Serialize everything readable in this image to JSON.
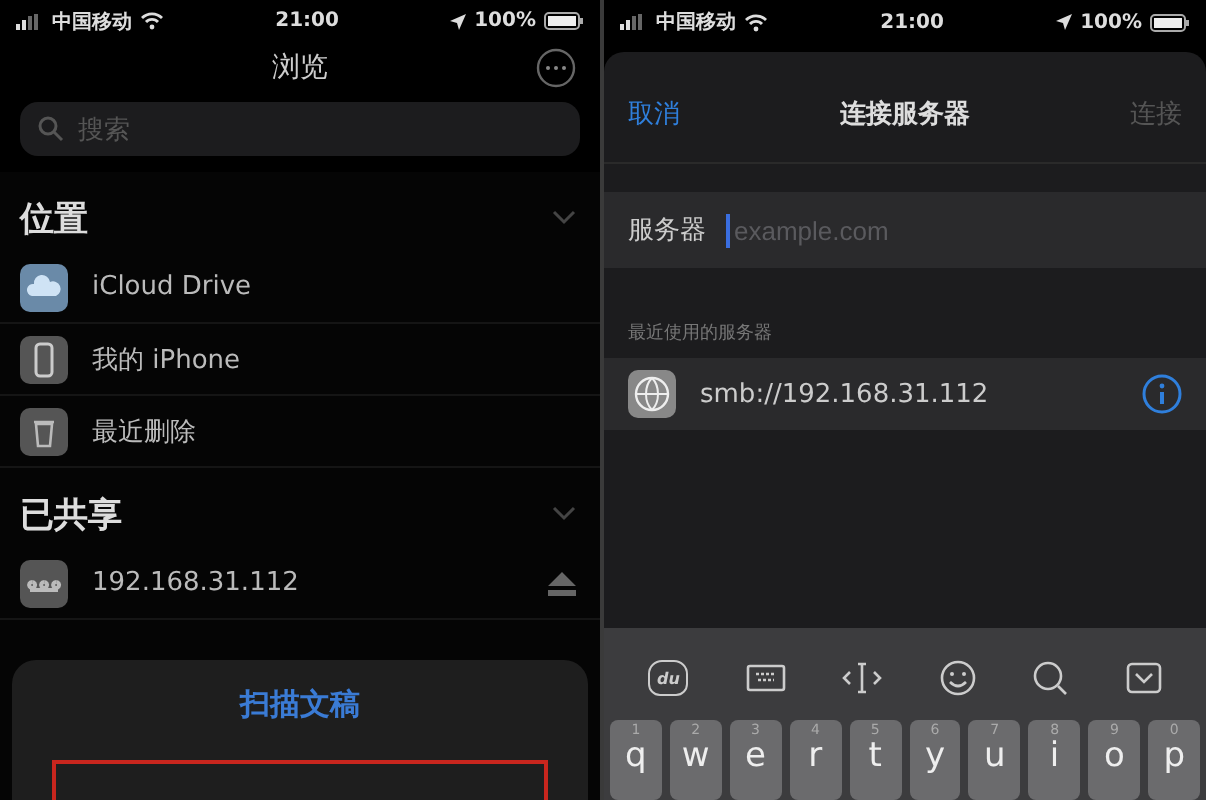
{
  "left": {
    "status": {
      "carrier": "中国移动",
      "time": "21:00",
      "battery": "100%"
    },
    "title": "浏览",
    "search": {
      "placeholder": "搜索"
    },
    "sections": [
      {
        "title": "位置",
        "expanded": true,
        "items": [
          {
            "label": "iCloud Drive",
            "kind": "cloud"
          },
          {
            "label": "我的 iPhone",
            "kind": "phone"
          },
          {
            "label": "最近删除",
            "kind": "trash"
          }
        ]
      },
      {
        "title": "已共享",
        "expanded": true,
        "items": [
          {
            "label": "192.168.31.112",
            "kind": "server"
          }
        ]
      }
    ],
    "sheet": {
      "action": "扫描文稿"
    }
  },
  "right": {
    "status": {
      "carrier": "中国移动",
      "time": "21:00",
      "battery": "100%"
    },
    "nav": {
      "cancel": "取消",
      "title": "连接服务器",
      "connect": "连接",
      "connect_disabled": true
    },
    "field": {
      "label": "服务器",
      "placeholder": "example.com"
    },
    "recent_header": "最近使用的服务器",
    "recent": [
      {
        "address": "smb://192.168.31.112"
      }
    ],
    "keyboard": {
      "logo": "du",
      "keys": [
        {
          "key": "q",
          "hint": "1"
        },
        {
          "key": "w",
          "hint": "2"
        },
        {
          "key": "e",
          "hint": "3"
        },
        {
          "key": "r",
          "hint": "4"
        },
        {
          "key": "t",
          "hint": "5"
        },
        {
          "key": "y",
          "hint": "6"
        },
        {
          "key": "u",
          "hint": "7"
        },
        {
          "key": "i",
          "hint": "8"
        },
        {
          "key": "o",
          "hint": "9"
        },
        {
          "key": "p",
          "hint": "0"
        }
      ]
    }
  }
}
